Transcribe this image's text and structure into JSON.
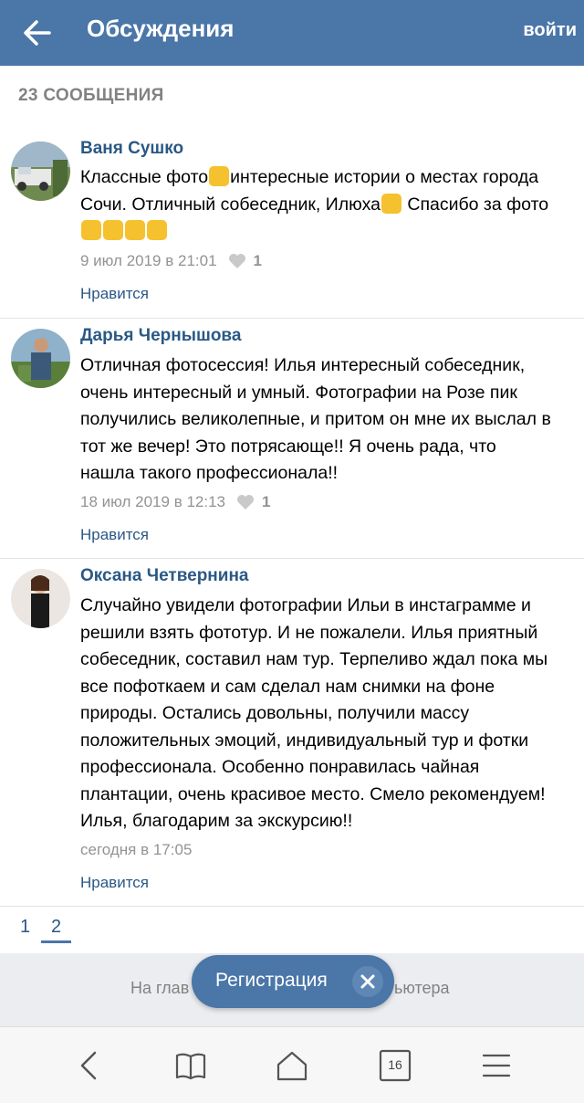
{
  "header": {
    "title": "Обсуждения",
    "login": "войти"
  },
  "count_label": "23 СООБЩЕНИЯ",
  "posts": [
    {
      "author": "Ваня Сушко",
      "text_line1a": "Классные фото",
      "text_line1b": "интересные истории о местах города",
      "text_line2a": "Сочи. Отличный собеседник, Илюха",
      "text_line2b": " Спасибо за фото",
      "date": "9 июл 2019 в 21:01",
      "likes": "1",
      "like_label": "Нравится"
    },
    {
      "author": "Дарья Чернышова",
      "text": "Отличная фотосессия! Илья интересный собеседник, очень интересный и умный. Фотографии на Розе пик получились великолепные, и притом он мне их выслал в тот же вечер! Это потрясающе!! Я очень рада, что нашла такого профессионала!!",
      "date": "18 июл 2019 в 12:13",
      "likes": "1",
      "like_label": "Нравится"
    },
    {
      "author": "Оксана Четвернина",
      "text": "Случайно увидели фотографии Ильи в инстаграмме и решили взять фототур. И не пожалели. Илья приятный собеседник, составил нам тур. Терпеливо ждал пока мы все пофоткаем и сам сделал нам снимки на фоне природы. Остались довольны, получили массу положительных эмоций, индивидуальный тур и фотки профессионала. Особенно понравилась чайная плантации, очень красивое место. Смело рекомендуем! Илья, благодарим за экскурсию!!",
      "date": "сегодня в 17:05",
      "like_label": "Нравится"
    }
  ],
  "pagination": {
    "pages": [
      "1",
      "2"
    ],
    "current": "2"
  },
  "footer": {
    "left_text": "На глав",
    "right_text": "ьютера"
  },
  "register": {
    "label": "Регистрация"
  },
  "browser_nav": {
    "tab_count": "16"
  },
  "colors": {
    "brand": "#4a76a8",
    "link": "#2a5885",
    "muted": "#939393"
  }
}
